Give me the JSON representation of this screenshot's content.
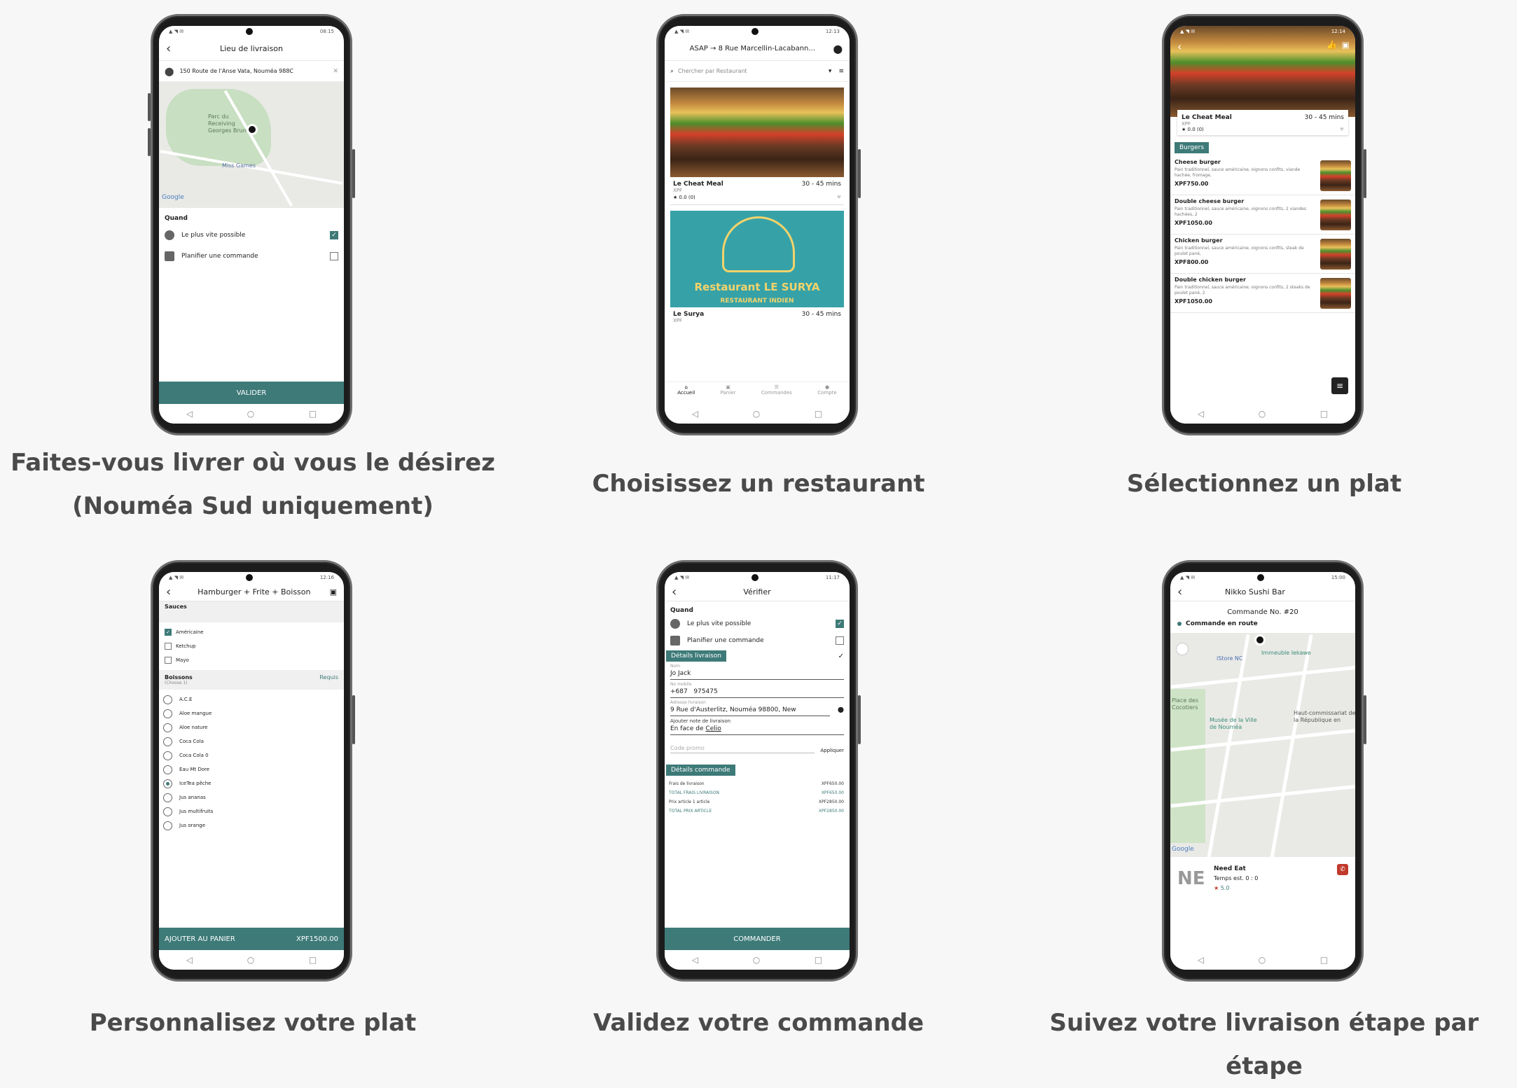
{
  "captions": {
    "c1_line1": "Faites-vous livrer où vous le désirez",
    "c1_line2": "(Nouméa Sud uniquement)",
    "c2": "Choisissez un restaurant",
    "c3": "Sélectionnez un plat",
    "c4": "Personnalisez votre plat",
    "c5": "Validez votre commande",
    "c6": "Suivez votre livraison étape par étape"
  },
  "accent": "#3d7a78",
  "status_times": [
    "08:15",
    "12:13",
    "12:14",
    "12:16",
    "11:17",
    "15:00"
  ],
  "s1": {
    "title": "Lieu de livraison",
    "address": "150 Route de l'Anse Vata, Nouméa 988C",
    "map_labels": [
      "Parc du Receiving Georges Brun",
      "Miss Games",
      "Google"
    ],
    "when_label": "Quand",
    "option_asap": "Le plus vite possible",
    "option_plan": "Planifier une commande",
    "validate": "VALIDER"
  },
  "s2": {
    "header": "ASAP → 8 Rue Marcellin-Lacabann...",
    "search_placeholder": "Chercher par Restaurant",
    "r1_name": "Le Cheat Meal",
    "r1_time": "30 - 45 mins",
    "r1_currency": "XPF",
    "r1_rating": "0.0 (0)",
    "r2_banner": "Restaurant LE SURYA",
    "r2_sub": "RESTAURANT INDIEN",
    "r2_name": "Le Surya",
    "r2_time": "30 - 45 mins",
    "r2_currency": "XPF",
    "tabs": [
      "Accueil",
      "Panier",
      "Commandes",
      "Compte"
    ]
  },
  "s3": {
    "name": "Le Cheat Meal",
    "time": "30 - 45 mins",
    "currency": "XPF",
    "rating": "0.0 (0)",
    "category": "Burgers",
    "items": [
      {
        "name": "Cheese burger",
        "desc": "Pain traditionnel, sauce américaine, oignons confits, viande hachée, fromage,",
        "price": "XPF750.00"
      },
      {
        "name": "Double cheese burger",
        "desc": "Pain traditionnel, sauce américaine, oignons confits, 2 viandes hachées, 2",
        "price": "XPF1050.00"
      },
      {
        "name": "Chicken burger",
        "desc": "Pain traditionnel, sauce américaine, oignons confits, steak de poulet pané,",
        "price": "XPF800.00"
      },
      {
        "name": "Double chicken burger",
        "desc": "Pain traditionnel, sauce américaine, oignons confits, 2 steaks de poulet pané, 2",
        "price": "XPF1050.00"
      }
    ]
  },
  "s4": {
    "title": "Hamburger + Frite + Boisson",
    "sauces_label": "Sauces",
    "sauces": [
      {
        "label": "Américaine",
        "checked": true
      },
      {
        "label": "Ketchup",
        "checked": false
      },
      {
        "label": "Mayo",
        "checked": false
      }
    ],
    "drinks_label": "Boissons",
    "drinks_sub": "(Choose 1)",
    "required": "Requis",
    "drinks": [
      {
        "label": "A.C.E",
        "checked": false
      },
      {
        "label": "Aloe mangue",
        "checked": false
      },
      {
        "label": "Aloe nature",
        "checked": false
      },
      {
        "label": "Coca Cola",
        "checked": false
      },
      {
        "label": "Coca Cola 0",
        "checked": false
      },
      {
        "label": "Eau Mt Dore",
        "checked": false
      },
      {
        "label": "IceTea pêche",
        "checked": true
      },
      {
        "label": "Jus ananas",
        "checked": false
      },
      {
        "label": "Jus multifruits",
        "checked": false
      },
      {
        "label": "Jus orange",
        "checked": false
      }
    ],
    "add_to_cart": "AJOUTER AU PANIER",
    "total": "XPF1500.00"
  },
  "s5": {
    "title": "Vérifier",
    "when_label": "Quand",
    "option_asap": "Le plus vite possible",
    "option_plan": "Planifier une commande",
    "delivery_tag": "Détails livraison",
    "name_label": "Nom",
    "name_value": "Jo Jack",
    "phone_label": "No mobile",
    "phone_code": "+687",
    "phone_value": "975475",
    "address_label": "Adresse livraison",
    "address_value": "9 Rue d'Austerlitz, Nouméa 98800, New",
    "note_label": "Ajouter note de livraison",
    "note_value_pre": "En face de ",
    "note_value_link": "Celio",
    "promo_placeholder": "Code promo",
    "apply": "Appliquer",
    "order_tag": "Détails commande",
    "lines": [
      {
        "label": "Frais de livraison",
        "value": "XPF650.00",
        "accent": false
      },
      {
        "label": "TOTAL FRAIS LIVRAISON",
        "value": "XPF650.00",
        "accent": true
      },
      {
        "label": "Prix article 1 article",
        "value": "XPF2850.00",
        "accent": false
      },
      {
        "label": "TOTAL PRIX ARTICLE",
        "value": "XPF2850.00",
        "accent": true
      }
    ],
    "order_button": "COMMANDER"
  },
  "s6": {
    "title": "Nikko Sushi Bar",
    "order_no": "Commande No. #20",
    "status": "Commande en route",
    "map_labels": [
      "iStore NC",
      "Immeuble Iekawe",
      "Place des Cocotiers",
      "Musée de la Ville de Nouméa",
      "Haut-commissariat de la République en",
      "Google"
    ],
    "driver_logo": "NE",
    "driver_name": "Need Eat",
    "eta": "Temps est. 0 : 0",
    "rating": "5.0"
  }
}
